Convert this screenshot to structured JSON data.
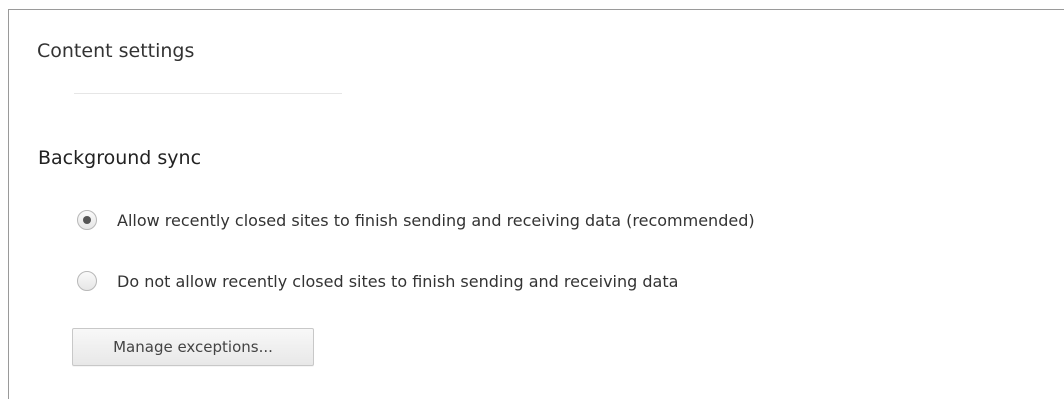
{
  "dialog": {
    "title": "Content settings"
  },
  "section": {
    "title": "Background sync",
    "options": [
      {
        "label": "Allow recently closed sites to finish sending and receiving data (recommended)",
        "selected": true
      },
      {
        "label": "Do not allow recently closed sites to finish sending and receiving data",
        "selected": false
      }
    ],
    "manage_label": "Manage exceptions..."
  }
}
